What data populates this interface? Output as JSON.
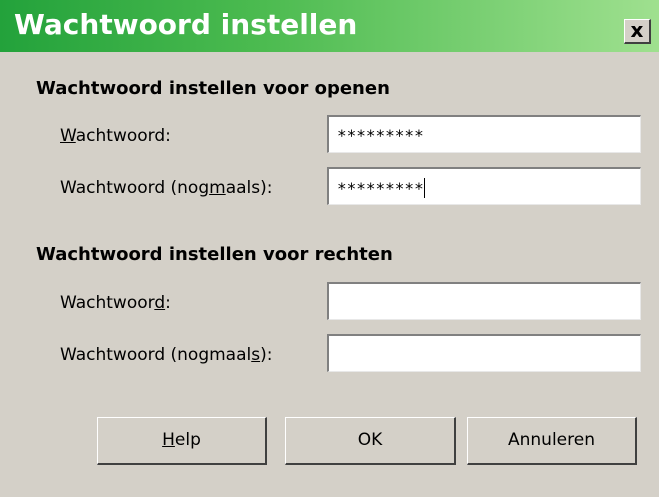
{
  "dialog": {
    "title": "Wachtwoord instellen",
    "close_symbol": "x"
  },
  "open_section": {
    "heading": "Wachtwoord instellen voor openen",
    "password": {
      "label_key": "W",
      "label_rest": "achtwoord:",
      "value": "*********"
    },
    "confirm": {
      "label_before": "Wachtwoord (nog",
      "label_key": "m",
      "label_after": "aals):",
      "value": "*********"
    }
  },
  "rights_section": {
    "heading": "Wachtwoord instellen voor rechten",
    "password": {
      "label_before": "Wachtwoor",
      "label_key": "d",
      "label_after": ":",
      "value": ""
    },
    "confirm": {
      "label_before": "Wachtwoord (nogmaal",
      "label_key": "s",
      "label_after": "):",
      "value": ""
    }
  },
  "buttons": {
    "help_key": "H",
    "help_rest": "elp",
    "ok": "OK",
    "cancel": "Annuleren"
  },
  "colors": {
    "titlebar_start": "#23a23b",
    "titlebar_end": "#9fe08f",
    "dialog_bg": "#d4d0c8"
  }
}
